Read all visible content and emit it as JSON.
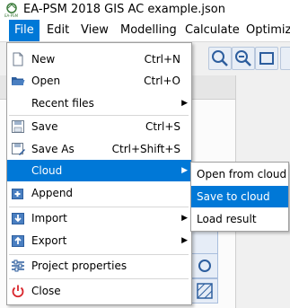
{
  "window": {
    "title": "EA-PSM 2018 GIS AC example.json",
    "app_icon": "ea-psm-logo"
  },
  "menubar": {
    "items": [
      "File",
      "Edit",
      "View",
      "Modelling",
      "Calculate",
      "Optimize"
    ],
    "active": "File"
  },
  "file_menu": {
    "items": [
      {
        "label": "New",
        "shortcut": "Ctrl+N",
        "icon": "new-file-icon"
      },
      {
        "label": "Open",
        "shortcut": "Ctrl+O",
        "icon": "open-folder-icon"
      },
      {
        "label": "Recent files",
        "shortcut": "",
        "submenu": true
      },
      {
        "label": "Save",
        "shortcut": "Ctrl+S",
        "icon": "save-icon"
      },
      {
        "label": "Save As",
        "shortcut": "Ctrl+Shift+S",
        "icon": "save-as-icon"
      },
      {
        "label": "Cloud",
        "shortcut": "",
        "submenu": true,
        "highlighted": true
      },
      {
        "label": "Append",
        "shortcut": "",
        "icon": "append-icon"
      },
      {
        "label": "Import",
        "shortcut": "",
        "submenu": true,
        "icon": "import-icon"
      },
      {
        "label": "Export",
        "shortcut": "",
        "submenu": true,
        "icon": "export-icon"
      },
      {
        "label": "Project properties",
        "shortcut": "",
        "icon": "properties-icon"
      },
      {
        "label": "Close",
        "shortcut": "",
        "icon": "power-icon"
      }
    ]
  },
  "cloud_submenu": {
    "items": [
      "Open from cloud",
      "Save to cloud",
      "Load result"
    ],
    "highlighted": "Save to cloud"
  },
  "colors": {
    "highlight": "#0078d7",
    "menu_bg": "#ffffff",
    "app_bg": "#f0f0f0"
  }
}
